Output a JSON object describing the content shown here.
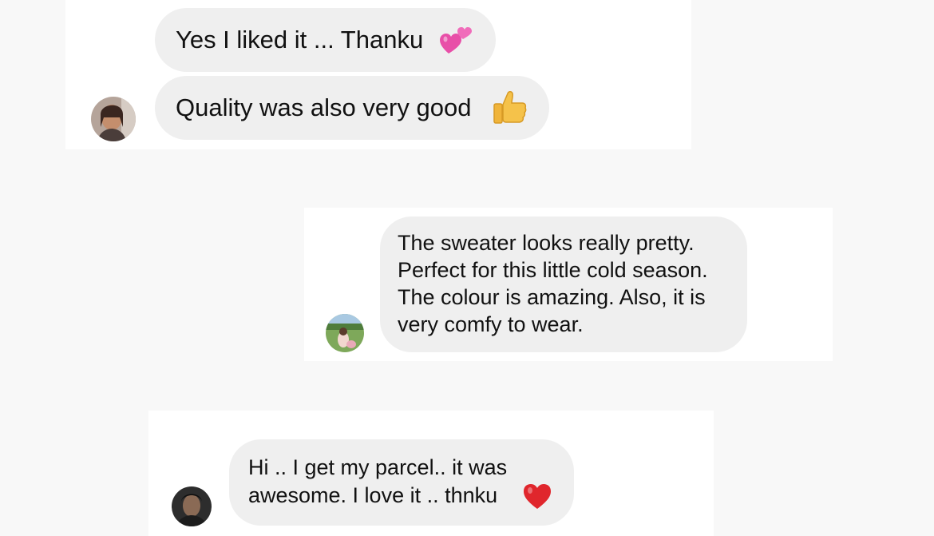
{
  "conversations": [
    {
      "messages": [
        {
          "text": "Yes I liked it ... Thanku",
          "emoji": "two-hearts-icon"
        },
        {
          "text": "Quality was also very good",
          "emoji": "thumbs-up-icon"
        }
      ],
      "avatar": "user-avatar-1"
    },
    {
      "messages": [
        {
          "text": "The sweater looks really pretty.\nPerfect for this little cold season.\nThe colour is amazing. Also, it is\nvery comfy to wear."
        }
      ],
      "avatar": "user-avatar-2"
    },
    {
      "messages": [
        {
          "text": "Hi .. I get my parcel.. it was\nawesome. I love it .. thnku",
          "emoji": "red-heart-icon"
        }
      ],
      "avatar": "user-avatar-3"
    }
  ],
  "colors": {
    "page_background": "#f8f8f8",
    "card_background": "#ffffff",
    "bubble_background": "#efefef",
    "text": "#111111",
    "heart_pink": "#e84fa8",
    "heart_red": "#e0262c",
    "thumb_yellow": "#f5c24a"
  }
}
